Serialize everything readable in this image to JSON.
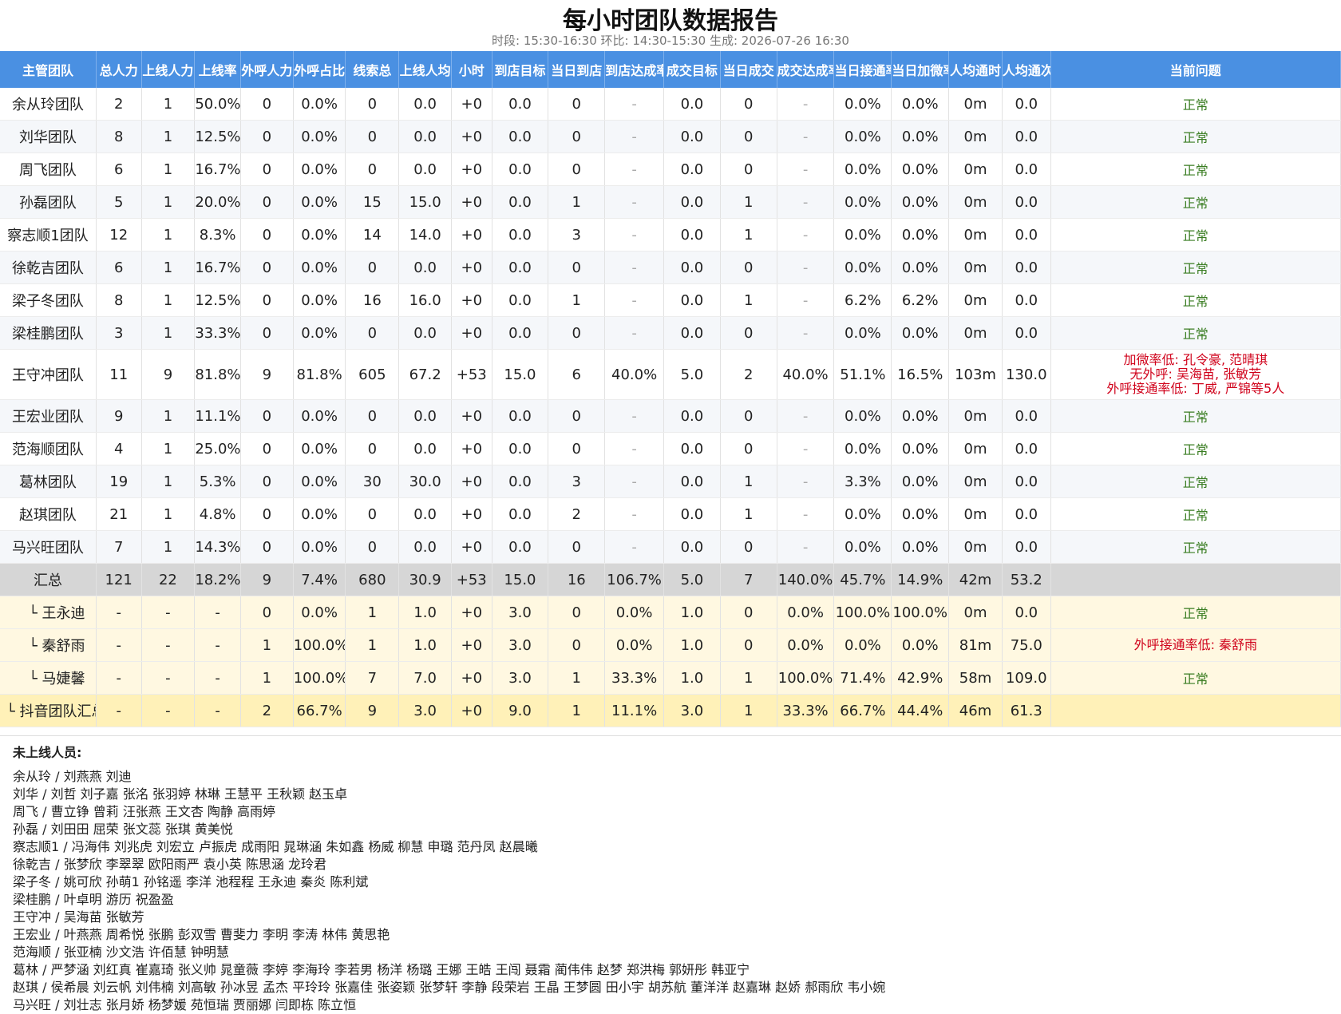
{
  "title": "每小时团队数据报告",
  "subtitle": "时段: 15:30-16:30  环比: 14:30-15:30  生成: 2026-07-26 16:30",
  "columns": [
    "主管团队",
    "总人力",
    "上线人力",
    "上线率",
    "外呼人力",
    "外呼占比",
    "线索总",
    "上线人均",
    "小时",
    "到店目标",
    "当日到店",
    "到店达成率",
    "成交目标",
    "当日成交",
    "成交达成率",
    "当日接通率",
    "当日加微率",
    "人均通时",
    "人均通次",
    "当前问题"
  ],
  "team_rows": [
    {
      "cells": [
        "余从玲团队",
        "2",
        "1",
        "50.0%",
        "0",
        "0.0%",
        "0",
        "0.0",
        "+0",
        "0.0",
        "0",
        "-",
        "0.0",
        "0",
        "-",
        "0.0%",
        "0.0%",
        "0m",
        "0.0"
      ],
      "issues": [
        "正常"
      ],
      "status": "ok"
    },
    {
      "cells": [
        "刘华团队",
        "8",
        "1",
        "12.5%",
        "0",
        "0.0%",
        "0",
        "0.0",
        "+0",
        "0.0",
        "0",
        "-",
        "0.0",
        "0",
        "-",
        "0.0%",
        "0.0%",
        "0m",
        "0.0"
      ],
      "issues": [
        "正常"
      ],
      "status": "ok"
    },
    {
      "cells": [
        "周飞团队",
        "6",
        "1",
        "16.7%",
        "0",
        "0.0%",
        "0",
        "0.0",
        "+0",
        "0.0",
        "0",
        "-",
        "0.0",
        "0",
        "-",
        "0.0%",
        "0.0%",
        "0m",
        "0.0"
      ],
      "issues": [
        "正常"
      ],
      "status": "ok"
    },
    {
      "cells": [
        "孙磊团队",
        "5",
        "1",
        "20.0%",
        "0",
        "0.0%",
        "15",
        "15.0",
        "+0",
        "0.0",
        "1",
        "-",
        "0.0",
        "1",
        "-",
        "0.0%",
        "0.0%",
        "0m",
        "0.0"
      ],
      "issues": [
        "正常"
      ],
      "status": "ok"
    },
    {
      "cells": [
        "察志顺1团队",
        "12",
        "1",
        "8.3%",
        "0",
        "0.0%",
        "14",
        "14.0",
        "+0",
        "0.0",
        "3",
        "-",
        "0.0",
        "1",
        "-",
        "0.0%",
        "0.0%",
        "0m",
        "0.0"
      ],
      "issues": [
        "正常"
      ],
      "status": "ok"
    },
    {
      "cells": [
        "徐乾吉团队",
        "6",
        "1",
        "16.7%",
        "0",
        "0.0%",
        "0",
        "0.0",
        "+0",
        "0.0",
        "0",
        "-",
        "0.0",
        "0",
        "-",
        "0.0%",
        "0.0%",
        "0m",
        "0.0"
      ],
      "issues": [
        "正常"
      ],
      "status": "ok"
    },
    {
      "cells": [
        "梁子冬团队",
        "8",
        "1",
        "12.5%",
        "0",
        "0.0%",
        "16",
        "16.0",
        "+0",
        "0.0",
        "1",
        "-",
        "0.0",
        "1",
        "-",
        "6.2%",
        "6.2%",
        "0m",
        "0.0"
      ],
      "issues": [
        "正常"
      ],
      "status": "ok"
    },
    {
      "cells": [
        "梁桂鹏团队",
        "3",
        "1",
        "33.3%",
        "0",
        "0.0%",
        "0",
        "0.0",
        "+0",
        "0.0",
        "0",
        "-",
        "0.0",
        "0",
        "-",
        "0.0%",
        "0.0%",
        "0m",
        "0.0"
      ],
      "issues": [
        "正常"
      ],
      "status": "ok"
    },
    {
      "cells": [
        "王守冲团队",
        "11",
        "9",
        "81.8%",
        "9",
        "81.8%",
        "605",
        "67.2",
        "+53",
        "15.0",
        "6",
        "40.0%",
        "5.0",
        "2",
        "40.0%",
        "51.1%",
        "16.5%",
        "103m",
        "130.0"
      ],
      "issues": [
        "加微率低: 孔令豪, 范晴琪",
        "无外呼: 吴海苗, 张敏芳",
        "外呼接通率低: 丁威, 严锦等5人"
      ],
      "status": "warn"
    },
    {
      "cells": [
        "王宏业团队",
        "9",
        "1",
        "11.1%",
        "0",
        "0.0%",
        "0",
        "0.0",
        "+0",
        "0.0",
        "0",
        "-",
        "0.0",
        "0",
        "-",
        "0.0%",
        "0.0%",
        "0m",
        "0.0"
      ],
      "issues": [
        "正常"
      ],
      "status": "ok"
    },
    {
      "cells": [
        "范海顺团队",
        "4",
        "1",
        "25.0%",
        "0",
        "0.0%",
        "0",
        "0.0",
        "+0",
        "0.0",
        "0",
        "-",
        "0.0",
        "0",
        "-",
        "0.0%",
        "0.0%",
        "0m",
        "0.0"
      ],
      "issues": [
        "正常"
      ],
      "status": "ok"
    },
    {
      "cells": [
        "葛林团队",
        "19",
        "1",
        "5.3%",
        "0",
        "0.0%",
        "30",
        "30.0",
        "+0",
        "0.0",
        "3",
        "-",
        "0.0",
        "1",
        "-",
        "3.3%",
        "0.0%",
        "0m",
        "0.0"
      ],
      "issues": [
        "正常"
      ],
      "status": "ok"
    },
    {
      "cells": [
        "赵琪团队",
        "21",
        "1",
        "4.8%",
        "0",
        "0.0%",
        "0",
        "0.0",
        "+0",
        "0.0",
        "2",
        "-",
        "0.0",
        "1",
        "-",
        "0.0%",
        "0.0%",
        "0m",
        "0.0"
      ],
      "issues": [
        "正常"
      ],
      "status": "ok"
    },
    {
      "cells": [
        "马兴旺团队",
        "7",
        "1",
        "14.3%",
        "0",
        "0.0%",
        "0",
        "0.0",
        "+0",
        "0.0",
        "0",
        "-",
        "0.0",
        "0",
        "-",
        "0.0%",
        "0.0%",
        "0m",
        "0.0"
      ],
      "issues": [
        "正常"
      ],
      "status": "ok"
    }
  ],
  "total_row": {
    "cells": [
      "汇总",
      "121",
      "22",
      "18.2%",
      "9",
      "7.4%",
      "680",
      "30.9",
      "+53",
      "15.0",
      "16",
      "106.7%",
      "5.0",
      "7",
      "140.0%",
      "45.7%",
      "14.9%",
      "42m",
      "53.2"
    ],
    "issues": [
      ""
    ]
  },
  "member_rows": [
    {
      "cells": [
        "└ 王永迪",
        "-",
        "-",
        "-",
        "0",
        "0.0%",
        "1",
        "1.0",
        "+0",
        "3.0",
        "0",
        "0.0%",
        "1.0",
        "0",
        "0.0%",
        "100.0%",
        "100.0%",
        "0m",
        "0.0"
      ],
      "issues": [
        "正常"
      ],
      "status": "ok"
    },
    {
      "cells": [
        "└ 秦舒雨",
        "-",
        "-",
        "-",
        "1",
        "100.0%",
        "1",
        "1.0",
        "+0",
        "3.0",
        "0",
        "0.0%",
        "1.0",
        "0",
        "0.0%",
        "0.0%",
        "0.0%",
        "81m",
        "75.0"
      ],
      "issues": [
        "外呼接通率低: 秦舒雨"
      ],
      "status": "warn"
    },
    {
      "cells": [
        "└ 马婕馨",
        "-",
        "-",
        "-",
        "1",
        "100.0%",
        "7",
        "7.0",
        "+0",
        "3.0",
        "1",
        "33.3%",
        "1.0",
        "1",
        "100.0%",
        "71.4%",
        "42.9%",
        "58m",
        "109.0"
      ],
      "issues": [
        "正常"
      ],
      "status": "ok"
    }
  ],
  "douyin_total_row": {
    "cells": [
      "└ 抖音团队汇总 -",
      "-",
      "-",
      "-",
      "2",
      "66.7%",
      "9",
      "3.0",
      "+0",
      "9.0",
      "1",
      "11.1%",
      "3.0",
      "1",
      "33.3%",
      "66.7%",
      "44.4%",
      "46m",
      "61.3"
    ],
    "issues": [
      ""
    ]
  },
  "offline_title": "未上线人员:",
  "offline_lines": [
    "余从玲 / 刘燕燕 刘迪",
    "刘华 / 刘哲 刘子嘉 张洺 张羽婷 林琳 王慧平 王秋颖 赵玉卓",
    "周飞 / 曹立铮 曾莉 汪张燕 王文杏 陶静 高雨婷",
    "孙磊 / 刘田田 屈荣 张文蕊 张琪 黄美悦",
    "察志顺1 / 冯海伟 刘兆虎 刘宏立 卢振虎 成雨阳 晁琳涵 朱如鑫 杨威 柳慧 申璐 范丹凤 赵晨曦",
    "徐乾吉 / 张梦欣 李翠翠 欧阳雨严 袁小英 陈思涵 龙玲君",
    "梁子冬 / 姚可欣 孙萌1 孙铭遥 李洋 池程程 王永迪 秦炎 陈利斌",
    "梁桂鹏 / 叶卓明 游历 祝盈盈",
    "王守冲 / 吴海苗 张敏芳",
    "王宏业 / 叶燕燕 周希悦 张鹏 彭双雪 曹斐力 李明 李涛 林伟 黄思艳",
    "范海顺 / 张亚楠 沙文浩 许佰慧 钟明慧",
    "葛林 / 严梦涵 刘红真 崔嘉琦 张义帅 晁童薇 李婷 李海玲 李若男 杨洋 杨璐 王娜 王皓 王闯 聂霜 蔺伟伟 赵梦 郑洪梅 郭妍彤 韩亚宁",
    "赵琪 / 侯希晨 刘云帆 刘伟楠 刘高敏 孙冰昱 孟杰 平玲玲 张嘉佳 张姿颖 张梦轩 李静 段荣岩 王晶 王梦圆 田小宇 胡苏航 董洋洋 赵嘉琳 赵娇 郝雨欣 韦小婉",
    "马兴旺 / 刘壮志 张月娇 杨梦媛 苑恒瑞 贾丽娜 闫即栋 陈立恒"
  ]
}
